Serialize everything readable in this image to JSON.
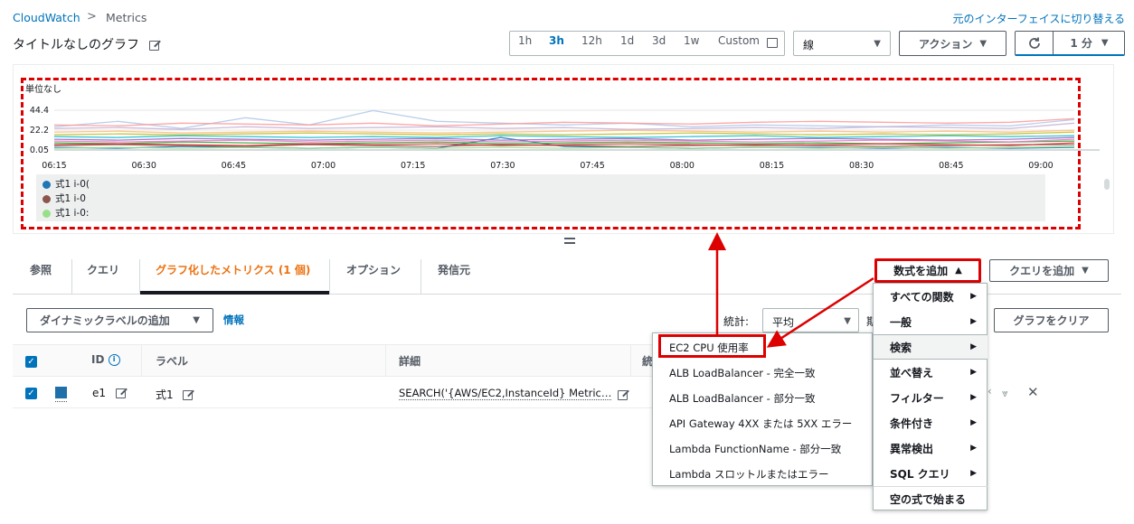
{
  "header": {
    "breadcrumb_root": "CloudWatch",
    "breadcrumb_sep": ">",
    "breadcrumb_current": "Metrics",
    "switch_link": "元のインターフェイスに切り替える",
    "graph_title": "タイトルなしのグラフ"
  },
  "toolbar": {
    "time_ranges": [
      "1h",
      "3h",
      "12h",
      "1d",
      "3d",
      "1w",
      "Custom"
    ],
    "active_range": "3h",
    "chart_type_value": "線",
    "actions_label": "アクション",
    "period_label": "1 分"
  },
  "chart_data": {
    "type": "line",
    "ylabel": "単位なし",
    "y_ticks": [
      "44.4",
      "22.2",
      "0.05"
    ],
    "ylim": [
      0.05,
      44.4
    ],
    "x_ticks": [
      "06:15",
      "06:30",
      "06:45",
      "07:00",
      "07:15",
      "07:30",
      "07:45",
      "08:00",
      "08:15",
      "08:30",
      "08:45",
      "09:00"
    ],
    "legend": [
      {
        "name": "式1 i-0(",
        "color": "#1f77b4"
      },
      {
        "name": "式1 i-0",
        "color": "#8c564b"
      },
      {
        "name": "式1 i-0:",
        "color": "#98df8a"
      }
    ],
    "series": [
      {
        "color": "#1f77b4",
        "values": [
          3,
          2,
          4,
          3,
          2,
          3,
          2,
          14,
          4,
          3,
          2,
          3,
          3,
          2,
          3,
          2,
          3
        ]
      },
      {
        "color": "#aec7e8",
        "values": [
          26,
          32,
          24,
          36,
          28,
          44,
          32,
          30,
          28,
          30,
          26,
          28,
          27,
          26,
          28,
          27,
          34
        ]
      },
      {
        "color": "#ff9896",
        "values": [
          28,
          27,
          30,
          29,
          28,
          30,
          27,
          29,
          31,
          30,
          29,
          31,
          32,
          31,
          30,
          31,
          35
        ]
      },
      {
        "color": "#c5b0d5",
        "values": [
          24,
          25,
          23,
          26,
          24,
          25,
          26,
          24,
          25,
          23,
          24,
          25,
          24,
          26,
          25,
          24,
          30
        ]
      },
      {
        "color": "#ffbb78",
        "values": [
          20,
          21,
          19,
          20,
          21,
          20,
          19,
          20,
          21,
          22,
          21,
          20,
          21,
          20,
          21,
          20,
          22
        ]
      },
      {
        "color": "#bcbd22",
        "values": [
          17,
          18,
          17,
          18,
          19,
          18,
          17,
          18,
          17,
          18,
          19,
          18,
          17,
          18,
          17,
          18,
          20
        ]
      },
      {
        "color": "#2ca02c",
        "values": [
          8,
          7,
          9,
          8,
          7,
          8,
          9,
          7,
          8,
          9,
          8,
          7,
          8,
          7,
          8,
          9,
          10
        ]
      },
      {
        "color": "#8c564b",
        "values": [
          5,
          6,
          5,
          4,
          6,
          5,
          4,
          6,
          5,
          4,
          5,
          6,
          5,
          4,
          5,
          6,
          6
        ]
      },
      {
        "color": "#9467bd",
        "values": [
          12,
          11,
          13,
          12,
          11,
          12,
          13,
          11,
          12,
          13,
          11,
          12,
          13,
          12,
          11,
          12,
          14
        ]
      },
      {
        "color": "#e377c2",
        "values": [
          10,
          9,
          10,
          11,
          9,
          10,
          11,
          9,
          10,
          11,
          10,
          9,
          10,
          11,
          10,
          9,
          12
        ]
      },
      {
        "color": "#17becf",
        "values": [
          15,
          14,
          16,
          15,
          14,
          15,
          14,
          16,
          15,
          14,
          15,
          16,
          14,
          15,
          16,
          15,
          16
        ]
      },
      {
        "color": "#d62728",
        "values": [
          6,
          7,
          6,
          5,
          7,
          6,
          7,
          5,
          6,
          7,
          6,
          5,
          6,
          7,
          6,
          5,
          8
        ]
      },
      {
        "color": "#98df8a",
        "values": [
          2,
          3,
          2,
          3,
          2,
          3,
          2,
          3,
          2,
          3,
          2,
          3,
          2,
          3,
          2,
          3,
          4
        ]
      }
    ]
  },
  "tabs": {
    "items": [
      "参照",
      "クエリ",
      "グラフ化したメトリクス (1 個)",
      "オプション",
      "発信元"
    ],
    "active": "グラフ化したメトリクス (1 個)"
  },
  "buttons": {
    "add_expression": "数式を追加",
    "add_query": "クエリを追加",
    "add_dynamic_label": "ダイナミックラベルの追加",
    "info_link": "情報",
    "clear_graph": "グラフをクリア"
  },
  "stats": {
    "label": "統計:",
    "value": "平均",
    "extra_letter": "期"
  },
  "table": {
    "headers": {
      "id": "ID",
      "label": "ラベル",
      "details": "詳細",
      "extra": "統"
    },
    "rows": [
      {
        "id": "e1",
        "label": "式1",
        "details": "SEARCH('{AWS/EC2,InstanceId} Metric…",
        "color": "#1f6fa8"
      }
    ]
  },
  "expression_menu": {
    "items": [
      {
        "label": "すべての関数",
        "arrow": "▶"
      },
      {
        "label": "一般",
        "arrow": "▶"
      },
      {
        "label": "検索",
        "arrow": "▶"
      },
      {
        "label": "並べ替え",
        "arrow": "▶"
      },
      {
        "label": "フィルター",
        "arrow": "▶"
      },
      {
        "label": "条件付き",
        "arrow": "▶"
      },
      {
        "label": "異常検出",
        "arrow": "▶"
      },
      {
        "label": "SQL クエリ",
        "arrow": "▶"
      },
      {
        "label": "空の式で始まる",
        "arrow": ""
      }
    ],
    "hovered": "検索"
  },
  "search_submenu": {
    "items": [
      "EC2 CPU 使用率",
      "ALB LoadBalancer - 完全一致",
      "ALB LoadBalancer - 部分一致",
      "API Gateway 4XX または 5XX エラー",
      "Lambda FunctionName - 部分一致",
      "Lambda スロットルまたはエラー"
    ],
    "highlighted": "EC2 CPU 使用率"
  },
  "colors": {
    "accent": "#ec7211",
    "link": "#0073bb",
    "annotation_red": "#dd0000"
  }
}
